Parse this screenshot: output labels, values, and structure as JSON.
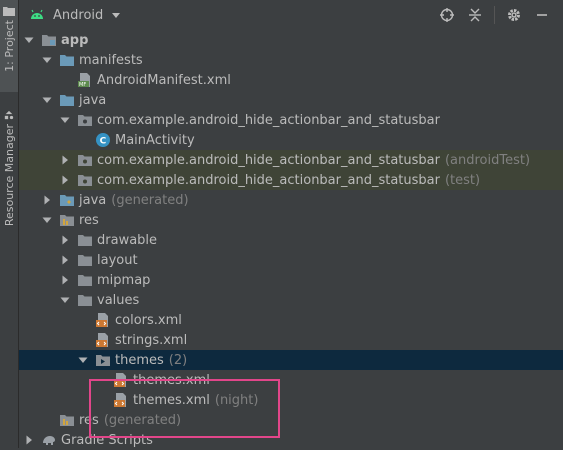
{
  "side": {
    "project_tab": "1: Project",
    "resource_tab": "Resource Manager"
  },
  "header": {
    "title": "Android"
  },
  "colors": {
    "folder_blue": "#6b9ab8",
    "folder_gray": "#8a8f94",
    "xml_orange": "#cc7832",
    "class_blue": "#3592c4",
    "manifest_green": "#5d8a4e",
    "highlight": "#e2468a"
  },
  "tree": [
    {
      "label": "app",
      "bold": true
    },
    {
      "label": "manifests"
    },
    {
      "label": "AndroidManifest.xml"
    },
    {
      "label": "java"
    },
    {
      "label": "com.example.android_hide_actionbar_and_statusbar"
    },
    {
      "label": "MainActivity"
    },
    {
      "label": "com.example.android_hide_actionbar_and_statusbar",
      "suffix": "(androidTest)"
    },
    {
      "label": "com.example.android_hide_actionbar_and_statusbar",
      "suffix": "(test)"
    },
    {
      "label": "java",
      "suffix": "(generated)"
    },
    {
      "label": "res"
    },
    {
      "label": "drawable"
    },
    {
      "label": "layout"
    },
    {
      "label": "mipmap"
    },
    {
      "label": "values"
    },
    {
      "label": "colors.xml"
    },
    {
      "label": "strings.xml"
    },
    {
      "label": "themes",
      "suffix": "(2)"
    },
    {
      "label": "themes.xml"
    },
    {
      "label": "themes.xml",
      "suffix": "(night)"
    },
    {
      "label": "res",
      "suffix": "(generated)"
    },
    {
      "label": "Gradle Scripts"
    }
  ]
}
